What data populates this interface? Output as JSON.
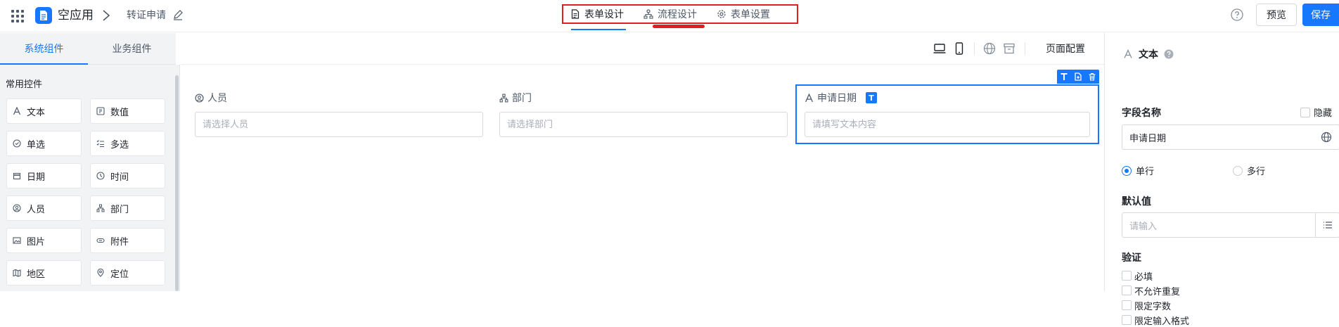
{
  "header": {
    "app_name": "空应用",
    "breadcrumb_current": "转证申请",
    "tabs": [
      {
        "label": "表单设计",
        "icon": "form-doc-icon"
      },
      {
        "label": "流程设计",
        "icon": "flow-icon"
      },
      {
        "label": "表单设置",
        "icon": "gear-icon"
      }
    ],
    "preview_label": "预览",
    "save_label": "保存",
    "accent": "#1677ff",
    "highlight": "#e02020"
  },
  "left": {
    "tabs": [
      "系统组件",
      "业务组件"
    ],
    "section_title": "常用控件",
    "components": [
      {
        "label": "文本",
        "icon": "text-icon"
      },
      {
        "label": "数值",
        "icon": "number-icon"
      },
      {
        "label": "单选",
        "icon": "radio-icon"
      },
      {
        "label": "多选",
        "icon": "checklist-icon"
      },
      {
        "label": "日期",
        "icon": "calendar-icon"
      },
      {
        "label": "时间",
        "icon": "clock-icon"
      },
      {
        "label": "人员",
        "icon": "person-icon"
      },
      {
        "label": "部门",
        "icon": "org-icon"
      },
      {
        "label": "图片",
        "icon": "image-icon"
      },
      {
        "label": "附件",
        "icon": "attachment-icon"
      },
      {
        "label": "地区",
        "icon": "map-icon"
      },
      {
        "label": "定位",
        "icon": "location-icon"
      }
    ]
  },
  "canvas": {
    "page_config_label": "页面配置",
    "fields": [
      {
        "label": "人员",
        "placeholder": "请选择人员",
        "icon": "person-icon"
      },
      {
        "label": "部门",
        "placeholder": "请选择部门",
        "icon": "org-icon"
      },
      {
        "label": "申请日期",
        "placeholder": "请填写文本内容",
        "icon": "text-icon",
        "badge": "T"
      }
    ]
  },
  "right": {
    "component_type": "文本",
    "field_name_label": "字段名称",
    "hidden_label": "隐藏",
    "field_name_value": "申请日期",
    "line_options": [
      "单行",
      "多行"
    ],
    "selected_line_option": "单行",
    "default_label": "默认值",
    "default_placeholder": "请输入",
    "verify_label": "验证",
    "verify_options": [
      "必填",
      "不允许重复",
      "限定字数",
      "限定输入格式"
    ]
  }
}
